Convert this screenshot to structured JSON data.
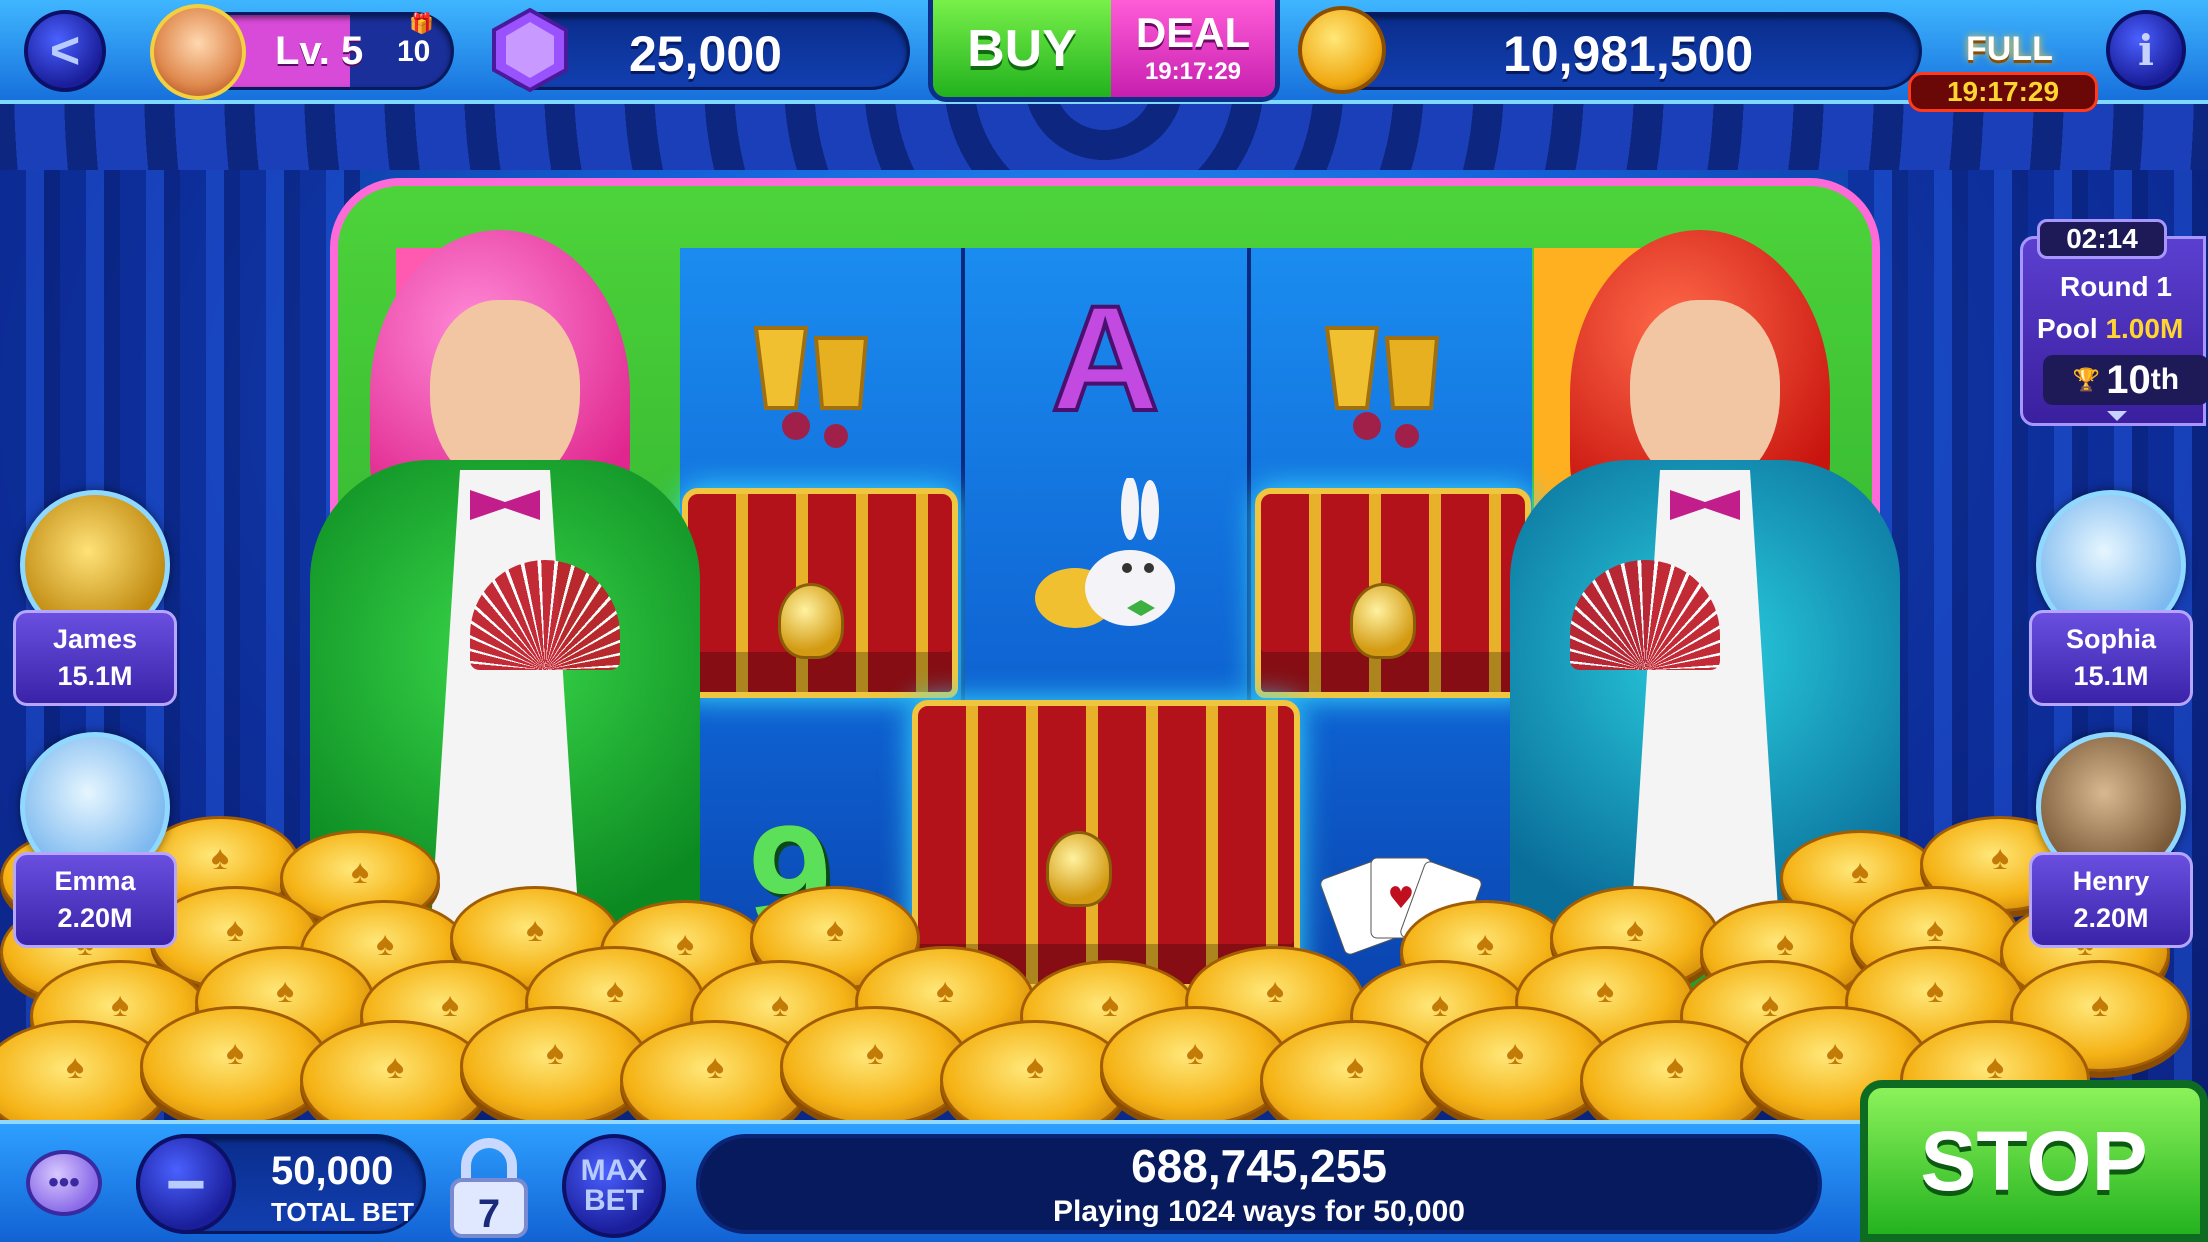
{
  "top_bar": {
    "level": "Lv. 5",
    "level_gift_count": "10",
    "gems": "25,000",
    "buy_label": "BUY",
    "deal_label": "DEAL",
    "deal_timer": "19:17:29",
    "coins": "10,981,500",
    "full_label": "FULL",
    "full_timer": "19:17:29",
    "info_label": "i",
    "back_label": "<"
  },
  "tournament": {
    "timer": "02:14",
    "round": "Round 1",
    "pool_label": "Pool",
    "pool_value": "1.00M",
    "rank_num": "10",
    "rank_suffix": "th"
  },
  "players": [
    {
      "name": "James",
      "score": "15.1M"
    },
    {
      "name": "Emma",
      "score": "2.20M"
    },
    {
      "name": "Sophia",
      "score": "15.1M"
    },
    {
      "name": "Henry",
      "score": "2.20M"
    }
  ],
  "reels": {
    "symbols": [
      "A",
      "9"
    ]
  },
  "bottom_bar": {
    "total_bet": "50,000",
    "total_bet_label": "TOTAL BET",
    "lock_number": "7",
    "max_bet_line1": "MAX",
    "max_bet_line2": "BET",
    "win_amount": "688,745,255",
    "ways_text": "Playing 1024 ways for 50,000",
    "stop_label": "STOP",
    "minus_label": "−"
  },
  "colors": {
    "accent_green": "#22b21e",
    "accent_pink": "#c61fb0",
    "panel_blue": "#071a5e",
    "tag_purple": "#3a23a8",
    "pool_yellow": "#ffd630"
  }
}
